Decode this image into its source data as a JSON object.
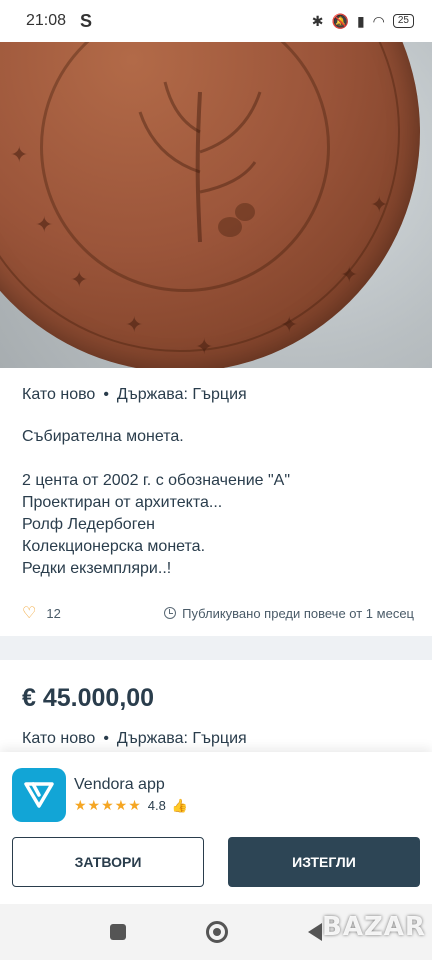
{
  "status_bar": {
    "time": "21:08",
    "carrier_icon": "S",
    "icons": [
      "bluetooth-icon",
      "mute-icon",
      "signal-icon",
      "wifi-icon"
    ],
    "battery": "25"
  },
  "gallery": {
    "image_count": 2,
    "active_index": 1,
    "icon": "coin-photo"
  },
  "listing": {
    "condition": "Като ново",
    "separator": "•",
    "country": "Държава: Гърция",
    "description_lines": [
      "Събирателна монета.",
      "",
      "2 цента от 2002 г. с обозначение \"А\"",
      "Проектиран от архитекта...",
      "Ролф Ледербоген",
      "Колекционерска монета.",
      "Редки екземпляри..!"
    ],
    "likes": "12",
    "published": "Публикувано преди повече от 1 месец"
  },
  "second_listing": {
    "price": "€ 45.000,00",
    "condition": "Като ново",
    "separator": "•",
    "country": "Държава: Гърция"
  },
  "app_banner": {
    "name": "Vendora app",
    "stars": "★★★★★",
    "rating": "4.8",
    "close_label": "ЗАТВОРИ",
    "download_label": "ИЗТЕГЛИ",
    "logo_color": "#12a5d6"
  },
  "watermark": "BAZAR"
}
